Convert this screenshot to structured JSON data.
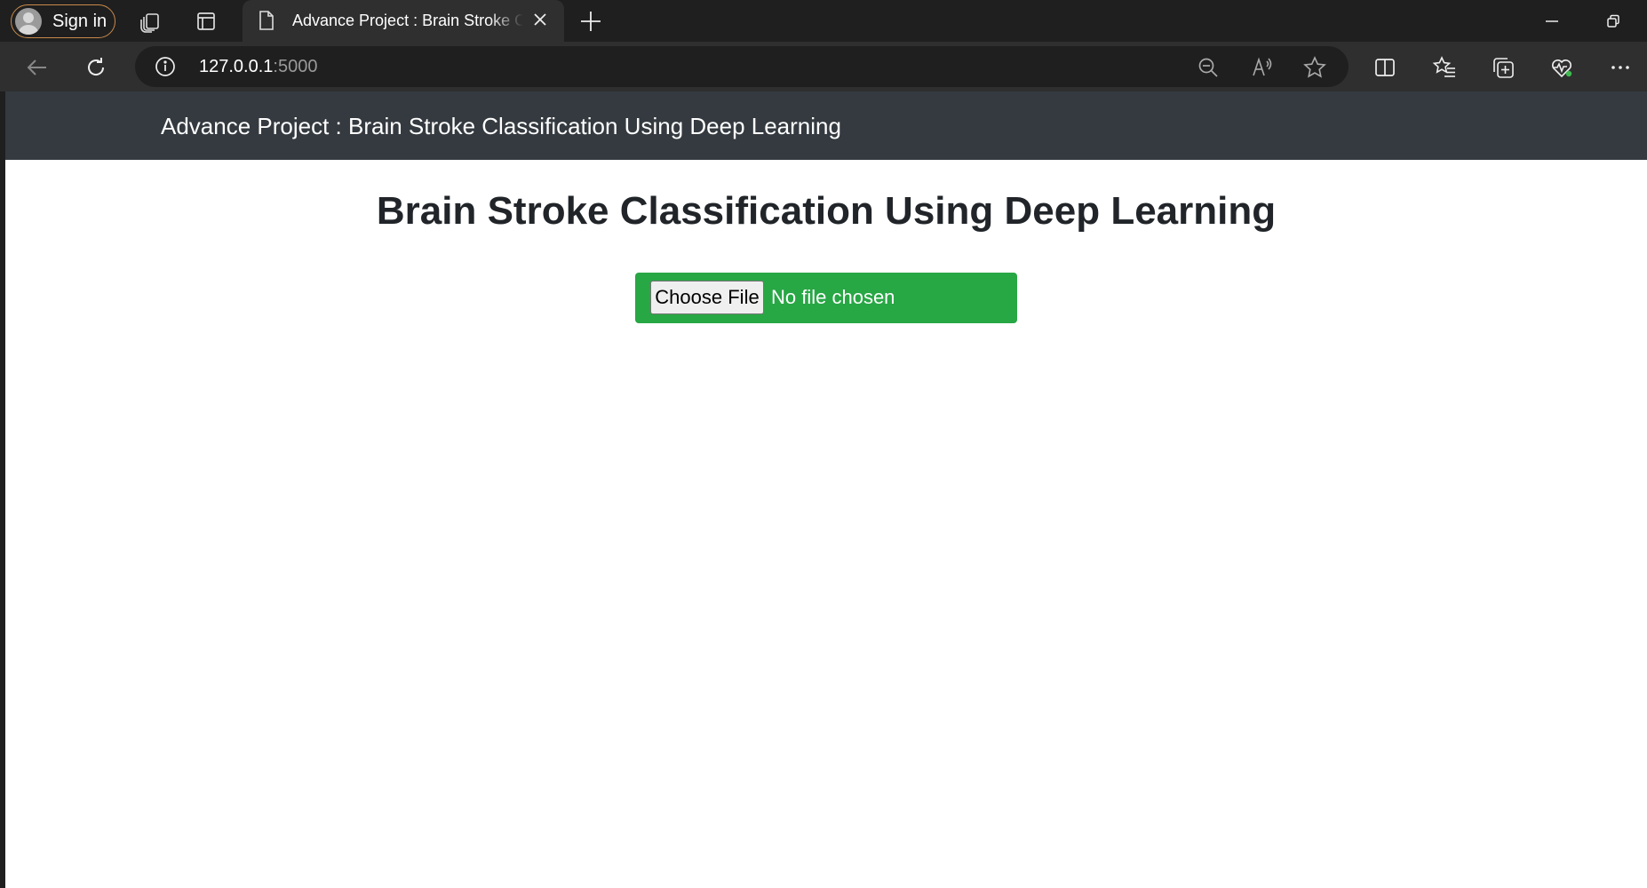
{
  "browser": {
    "signin_label": "Sign in",
    "tab_title": "Advance Project : Brain Stroke Classification Using Deep Learning",
    "url_host": "127.0.0.1",
    "url_port": ":5000"
  },
  "page": {
    "navbar_brand": "Advance Project : Brain Stroke Classification Using Deep Learning",
    "heading": "Brain Stroke Classification Using Deep Learning",
    "file_button_label": "Choose File",
    "file_status": "No file chosen",
    "accent_color": "#28a745",
    "navbar_color": "#343a40"
  },
  "icons": [
    "profile-avatar-icon",
    "workspaces-icon",
    "tab-actions-icon",
    "page-icon",
    "close-tab-icon",
    "new-tab-icon",
    "minimize-icon",
    "restore-icon",
    "back-icon",
    "refresh-icon",
    "site-info-icon",
    "zoom-out-icon",
    "read-aloud-icon",
    "favorite-star-icon",
    "split-screen-icon",
    "favorites-icon",
    "collections-icon",
    "browser-essentials-icon",
    "more-menu-icon"
  ]
}
